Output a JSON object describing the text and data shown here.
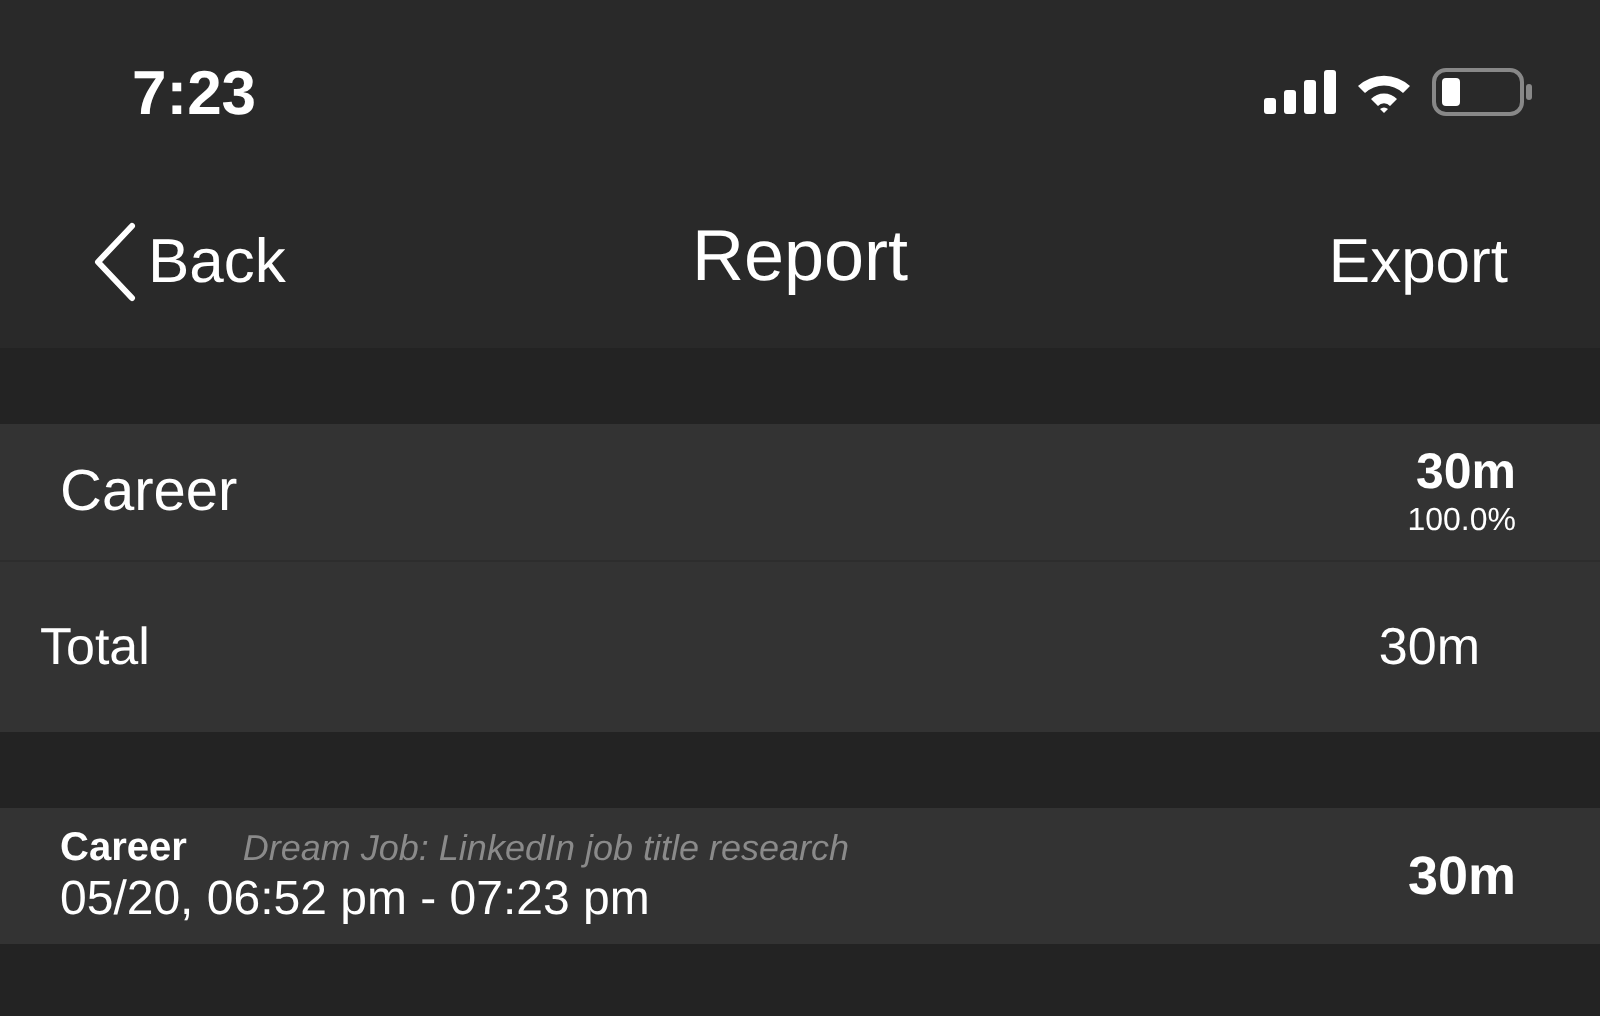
{
  "status_bar": {
    "time": "7:23"
  },
  "nav": {
    "back": "Back",
    "title": "Report",
    "action": "Export"
  },
  "summary": {
    "categories": [
      {
        "name": "Career",
        "duration": "30m",
        "percent": "100.0%"
      }
    ],
    "total": {
      "label": "Total",
      "duration": "30m"
    }
  },
  "entries": [
    {
      "category": "Career",
      "note": "Dream Job: LinkedIn job title research",
      "time_range": "05/20, 06:52 pm - 07:23 pm",
      "duration": "30m"
    }
  ]
}
